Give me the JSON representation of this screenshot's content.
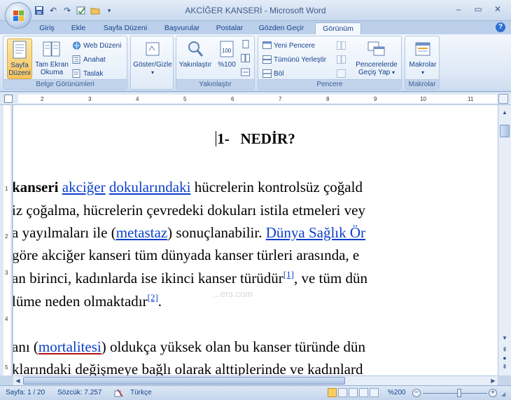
{
  "window": {
    "title": "AKCİĞER KANSERİ - Microsoft Word",
    "minimize": "–",
    "restore": "▭",
    "close": "✕"
  },
  "qat": {
    "save_icon": "save-icon",
    "undo_icon": "undo-icon",
    "redo_icon": "redo-icon"
  },
  "tabs": [
    "Giriş",
    "Ekle",
    "Sayfa Düzeni",
    "Başvurular",
    "Postalar",
    "Gözden Geçir",
    "Görünüm"
  ],
  "active_tab": "Görünüm",
  "ribbon": {
    "belge": {
      "label": "Belge Görünümleri",
      "sayfa_duzeni": "Sayfa Düzeni",
      "tam_ekran": "Tam Ekran Okuma",
      "web_duzeni": "Web Düzeni",
      "anahat": "Anahat",
      "taslak": "Taslak"
    },
    "goster": {
      "label": "Göster/Gizle"
    },
    "yakinlastir": {
      "label": "Yakınlaştır",
      "zoom_btn": "Yakınlaştır",
      "yuzde": "%100"
    },
    "pencere": {
      "label": "Pencere",
      "yeni": "Yeni Pencere",
      "tumunu": "Tümünü Yerleştir",
      "bol": "Böl",
      "gecis": "Pencerelerde Geçiş Yap"
    },
    "makrolar": {
      "label": "Makrolar",
      "btn": "Makrolar"
    }
  },
  "ruler": {
    "h_numbers": [
      "2",
      "3",
      "4",
      "5",
      "6",
      "7",
      "8",
      "9",
      "10",
      "11"
    ],
    "v_numbers": [
      "1",
      "2",
      "3",
      "4",
      "5"
    ]
  },
  "document": {
    "heading_num": "1-",
    "heading_text": "NEDİR?",
    "line1": {
      "bold": "kanseri",
      "link1": "akciğer",
      "link2": "dokularındaki",
      "rest": "hücrelerin kontrolsüz çoğald"
    },
    "line2": "iz çoğalma, hücrelerin çevredeki dokuları istila etmeleri vey",
    "line3": {
      "pre": "a yayılmaları ile (",
      "link": "metastaz",
      "mid": ") sonuçlanabilir.",
      "link2": "Dünya Sağlık Ör"
    },
    "line4": "göre akciğer kanseri tüm dünyada kanser türleri arasında, e",
    "line5": {
      "pre": "an birinci, kadınlarda ise ikinci kanser türüdür",
      "ref": "[1]",
      "post": ", ve tüm dün"
    },
    "line6": {
      "pre": "lümе neden olmaktadır",
      "ref": "[2]",
      "post": "."
    },
    "line7": {
      "pre": "anı (",
      "link": "mortalitesi",
      "post": ") oldukça yüksek olan bu kanser türünde dün"
    },
    "line8": "klarındaki değişmeye bağlı olarak alttiplerinde ve kadınlard",
    "watermark": "...ers.com"
  },
  "statusbar": {
    "page": "Sayfa: 1 / 20",
    "words": "Sözcük: 7.257",
    "language": "Türkçe",
    "zoom": "%200"
  }
}
